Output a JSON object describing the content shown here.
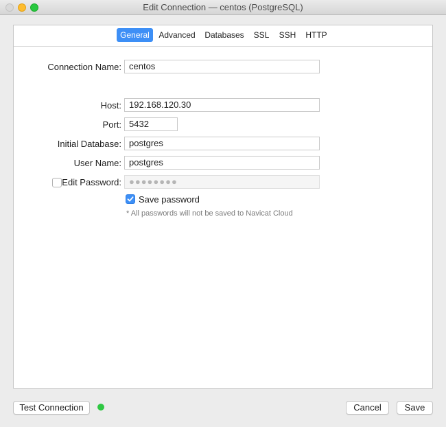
{
  "window": {
    "title": "Edit Connection — centos (PostgreSQL)"
  },
  "tabs": [
    {
      "label": "General",
      "active": true
    },
    {
      "label": "Advanced",
      "active": false
    },
    {
      "label": "Databases",
      "active": false
    },
    {
      "label": "SSL",
      "active": false
    },
    {
      "label": "SSH",
      "active": false
    },
    {
      "label": "HTTP",
      "active": false
    }
  ],
  "form": {
    "connection_name": {
      "label": "Connection Name:",
      "value": "centos"
    },
    "host": {
      "label": "Host:",
      "value": "192.168.120.30"
    },
    "port": {
      "label": "Port:",
      "value": "5432"
    },
    "initial_database": {
      "label": "Initial Database:",
      "value": "postgres"
    },
    "user_name": {
      "label": "User Name:",
      "value": "postgres"
    },
    "edit_password": {
      "label": "Edit Password:",
      "checked": false,
      "value": "●●●●●●●●"
    },
    "save_password": {
      "label": "Save password",
      "checked": true
    },
    "note": "* All passwords will not be saved to Navicat Cloud"
  },
  "footer": {
    "test_connection": "Test Connection",
    "cancel": "Cancel",
    "save": "Save"
  },
  "colors": {
    "accent": "#3d8ff6",
    "status_ok": "#2fc843"
  }
}
